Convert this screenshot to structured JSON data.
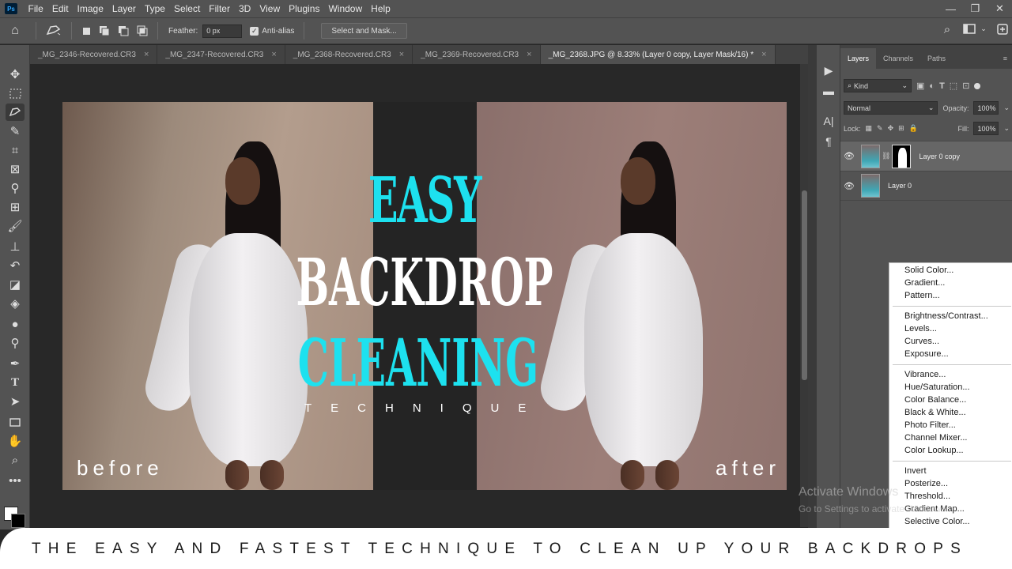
{
  "app": {
    "logo": "Ps"
  },
  "menu": [
    "File",
    "Edit",
    "Image",
    "Layer",
    "Type",
    "Select",
    "Filter",
    "3D",
    "View",
    "Plugins",
    "Window",
    "Help"
  ],
  "window_controls": {
    "minimize": "—",
    "restore": "❐",
    "close": "✕"
  },
  "options": {
    "feather_label": "Feather:",
    "feather_value": "0 px",
    "antialias_label": "Anti-alias",
    "antialias_checked": true,
    "select_mask_label": "Select and Mask..."
  },
  "tabs": [
    {
      "label": "_MG_2346-Recovered.CR3",
      "active": false
    },
    {
      "label": "_MG_2347-Recovered.CR3",
      "active": false
    },
    {
      "label": "_MG_2368-Recovered.CR3",
      "active": false
    },
    {
      "label": "_MG_2369-Recovered.CR3",
      "active": false
    },
    {
      "label": "_MG_2368.JPG @ 8.33% (Layer 0 copy, Layer Mask/16) *",
      "active": true
    }
  ],
  "tools": [
    "move-icon",
    "marquee-icon",
    "lasso-icon",
    "quick-select-icon",
    "crop-icon",
    "frame-icon",
    "eyedropper-icon",
    "healing-icon",
    "brush-icon",
    "stamp-icon",
    "history-brush-icon",
    "eraser-icon",
    "bucket-icon",
    "blur-icon",
    "dodge-icon",
    "pen-icon",
    "type-icon",
    "path-select-icon",
    "rectangle-icon",
    "hand-icon",
    "zoom-icon",
    "more-icon"
  ],
  "poster": {
    "line1": "EASY",
    "line2": "BACKDROP",
    "line3": "CLEANING",
    "line4": "TECHNIQUE",
    "before_label": "before",
    "after_label": "after"
  },
  "layers_panel": {
    "tabs": [
      "Layers",
      "Channels",
      "Paths"
    ],
    "active_tab": "Layers",
    "filter_kind": "Kind",
    "blend_mode": "Normal",
    "opacity_label": "Opacity:",
    "opacity_value": "100%",
    "lock_label": "Lock:",
    "fill_label": "Fill:",
    "fill_value": "100%",
    "layers": [
      {
        "name": "Layer 0 copy",
        "selected": true,
        "has_mask": true
      },
      {
        "name": "Layer 0",
        "selected": false,
        "has_mask": false
      }
    ]
  },
  "adjustment_menu": {
    "groups": [
      [
        "Solid Color...",
        "Gradient...",
        "Pattern..."
      ],
      [
        "Brightness/Contrast...",
        "Levels...",
        "Curves...",
        "Exposure..."
      ],
      [
        "Vibrance...",
        "Hue/Saturation...",
        "Color Balance...",
        "Black & White...",
        "Photo Filter...",
        "Channel Mixer...",
        "Color Lookup..."
      ],
      [
        "Invert",
        "Posterize...",
        "Threshold...",
        "Gradient Map...",
        "Selective Color..."
      ]
    ]
  },
  "watermark": {
    "line1": "Activate Windows",
    "line2": "Go to Settings to activate Windows."
  },
  "banner": "THE EASY AND FASTEST TECHNIQUE TO CLEAN UP YOUR BACKDROPS",
  "colors": {
    "cyan_title": "#1de1ef",
    "ui_gray": "#535353",
    "foreground": "#ffffff",
    "background": "#000000"
  }
}
